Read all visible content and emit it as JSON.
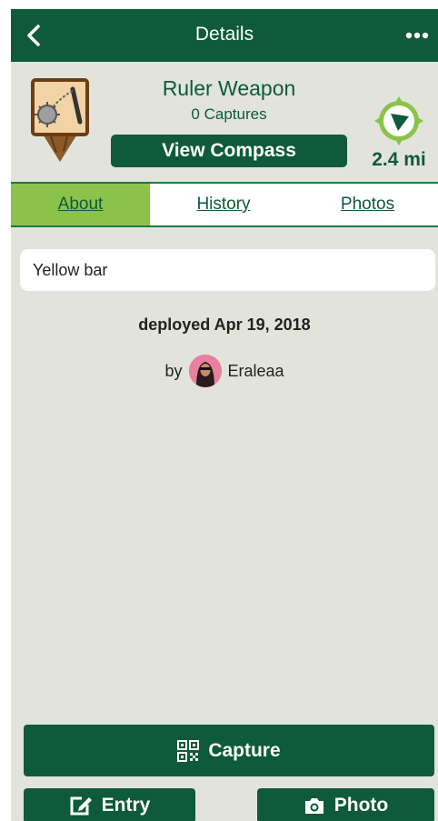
{
  "topbar": {
    "title": "Details",
    "back_icon": "chevron-left-icon",
    "more_icon": "more-dots-icon"
  },
  "item": {
    "name": "Ruler Weapon",
    "captures": "0 Captures",
    "view_compass_label": "View Compass",
    "distance": "2.4 mi",
    "pin_icon": "flail-weapon-pin-icon",
    "compass_icon": "compass-arrow-icon"
  },
  "tabs": [
    {
      "label": "About",
      "active": true
    },
    {
      "label": "History",
      "active": false
    },
    {
      "label": "Photos",
      "active": false
    }
  ],
  "about": {
    "description": "Yellow bar",
    "deployed": "deployed Apr 19, 2018",
    "by_prefix": "by",
    "author": "Eraleaa"
  },
  "actions": {
    "capture_label": "Capture",
    "entry_label": "Entry",
    "photo_label": "Photo",
    "capture_icon": "qr-code-icon",
    "entry_icon": "edit-icon",
    "photo_icon": "camera-icon"
  },
  "colors": {
    "primary": "#0e5a3b",
    "tab_active": "#8bc34a",
    "background": "#e2e4dc"
  }
}
